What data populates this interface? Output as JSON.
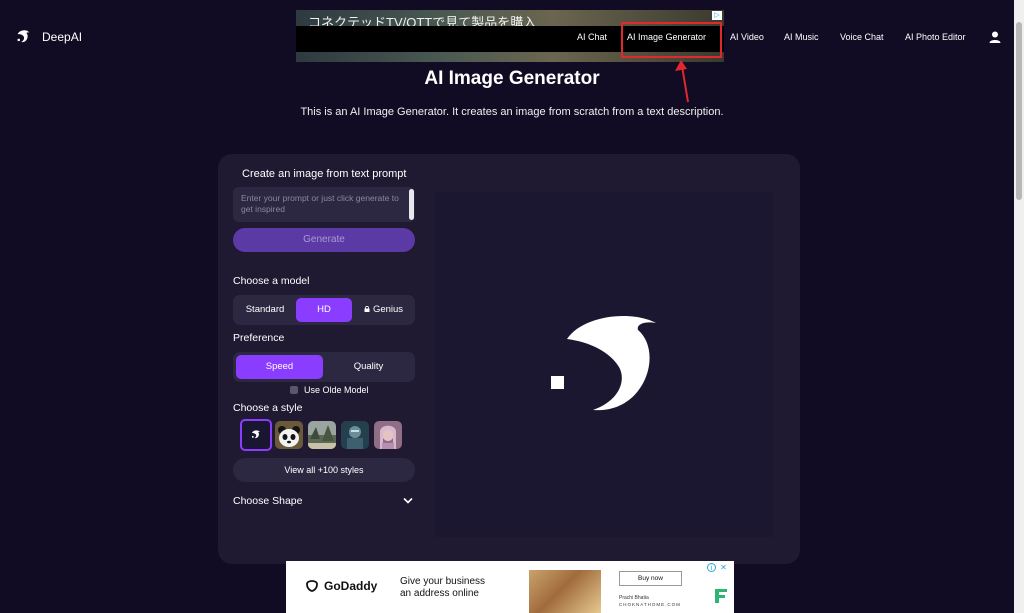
{
  "header": {
    "logo_text": "DeepAI",
    "nav": [
      {
        "label": "AI Chat",
        "name": "nav-ai-chat"
      },
      {
        "label": "AI Image Generator",
        "name": "nav-ai-image-generator"
      },
      {
        "label": "AI Video",
        "name": "nav-ai-video"
      },
      {
        "label": "AI Music",
        "name": "nav-ai-music"
      },
      {
        "label": "Voice Chat",
        "name": "nav-voice-chat"
      },
      {
        "label": "AI Photo Editor",
        "name": "nav-ai-photo-editor"
      }
    ],
    "user_icon": "user-icon",
    "highlighted_item": "AI Image Generator",
    "annotation_color": "#e0282e"
  },
  "top_ad": {
    "headline": "コネクテッドTV/OTTで見て製品を購入"
  },
  "page": {
    "title": "AI Image Generator",
    "subtitle": "This is an AI Image Generator. It creates an image from scratch from a text description."
  },
  "panel": {
    "heading": "Create an image from text prompt",
    "prompt_placeholder": "Enter your prompt or just click generate to get inspired",
    "prompt_value": "",
    "generate_label": "Generate",
    "model_label": "Choose a model",
    "models": [
      {
        "label": "Standard",
        "active": false
      },
      {
        "label": "HD",
        "active": true
      },
      {
        "label": "Genius",
        "active": false,
        "locked": true
      }
    ],
    "preference_label": "Preference",
    "preferences": [
      {
        "label": "Speed",
        "active": true
      },
      {
        "label": "Quality",
        "active": false
      }
    ],
    "old_model_label": "Use Olde Model",
    "old_model_checked": false,
    "style_label": "Choose a style",
    "styles": [
      {
        "name": "deepai-default-style",
        "selected": true
      },
      {
        "name": "panda-style",
        "selected": false
      },
      {
        "name": "landscape-style",
        "selected": false
      },
      {
        "name": "cyberpunk-style",
        "selected": false
      },
      {
        "name": "portrait-style",
        "selected": false
      }
    ],
    "view_all_label": "View all +100 styles",
    "shape_label": "Choose Shape"
  },
  "bottom_ad": {
    "brand": "GoDaddy",
    "headline_line1": "Give your business",
    "headline_line2": "an address online",
    "cta": "Buy now",
    "person_name": "Prachi Bhatia",
    "domain": "CHOKNATHOME.COM"
  },
  "colors": {
    "background": "#110c23",
    "card": "#1f1a32",
    "accent": "#8b3dff",
    "generate": "#5b3aa6"
  }
}
